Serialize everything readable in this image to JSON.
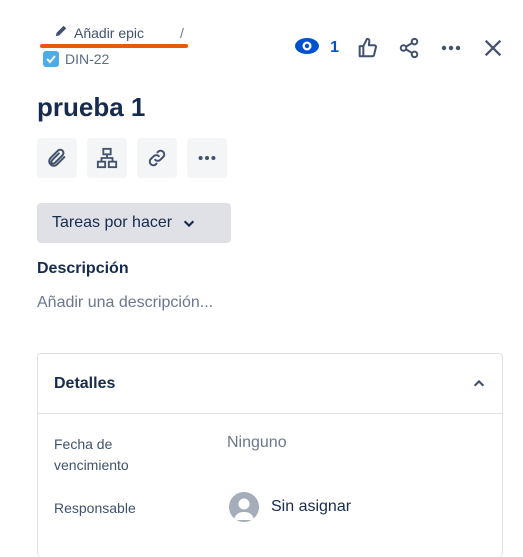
{
  "breadcrumb": {
    "epic_label": "Añadir epic",
    "separator": "/",
    "issue_key": "DIN-22"
  },
  "actions": {
    "watch_count": "1"
  },
  "issue": {
    "title": "prueba 1",
    "status": "Tareas por hacer"
  },
  "description": {
    "label": "Descripción",
    "placeholder": "Añadir una descripción..."
  },
  "details": {
    "title": "Detalles",
    "due_date_label_line1": "Fecha de",
    "due_date_label_line2": "vencimiento",
    "due_date_value": "Ninguno",
    "assignee_label": "Responsable",
    "assignee_value": "Sin asignar"
  },
  "colors": {
    "accent": "#0052cc",
    "underline": "#e8590c",
    "issue_type": "#4bade8"
  }
}
